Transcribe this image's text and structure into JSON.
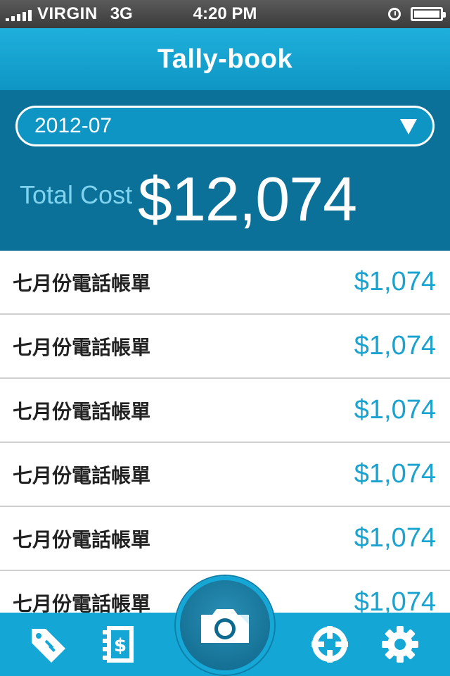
{
  "status_bar": {
    "carrier": "VIRGIN",
    "network": "3G",
    "time": "4:20 PM",
    "icons": [
      "signal-icon",
      "clock-icon",
      "battery-icon"
    ]
  },
  "nav": {
    "title": "Tally-book"
  },
  "summary": {
    "selected_month": "2012-07",
    "total_label": "Total Cost",
    "total_value": "$12,074"
  },
  "items": [
    {
      "name": "七月份電話帳單",
      "amount": "$1,074"
    },
    {
      "name": "七月份電話帳單",
      "amount": "$1,074"
    },
    {
      "name": "七月份電話帳單",
      "amount": "$1,074"
    },
    {
      "name": "七月份電話帳單",
      "amount": "$1,074"
    },
    {
      "name": "七月份電話帳單",
      "amount": "$1,074"
    },
    {
      "name": "七月份電話帳單",
      "amount": "$1,074"
    }
  ],
  "tab_bar": {
    "icons": [
      "tag-icon",
      "bill-icon",
      "camera-icon",
      "crosshair-icon",
      "gear-icon"
    ]
  },
  "colors": {
    "accent": "#14a7d6",
    "header_dark": "#0b7198",
    "amount_text": "#1aa3cf"
  }
}
